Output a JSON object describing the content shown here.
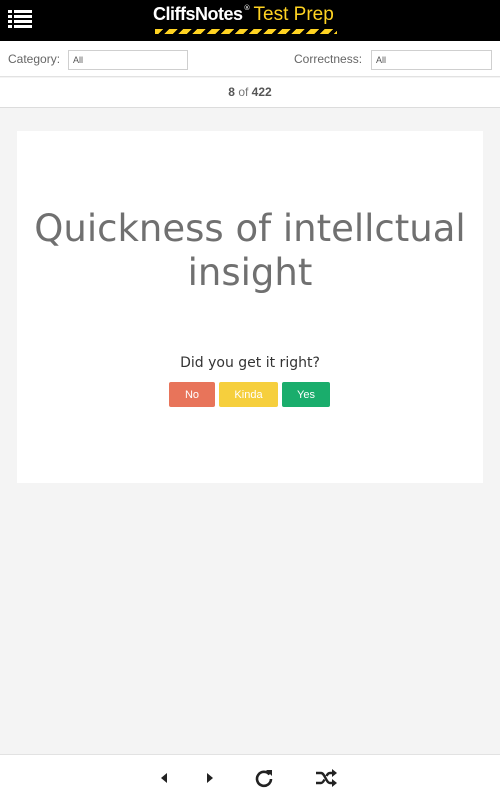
{
  "header": {
    "logo_main": "CliffsNotes",
    "logo_reg": "®",
    "logo_sub": "Test Prep",
    "menu_icon": "hamburger-list-icon"
  },
  "filters": {
    "category_label": "Category:",
    "category_value": "All",
    "correctness_label": "Correctness:",
    "correctness_value": "All"
  },
  "counter": {
    "current": "8",
    "of_text": "of",
    "total": "422"
  },
  "card": {
    "term": "Quickness of intellctual insight",
    "question": "Did you get it right?",
    "buttons": {
      "no": "No",
      "kinda": "Kinda",
      "yes": "Yes"
    }
  },
  "footer": {
    "icons": [
      "prev-arrow-icon",
      "next-arrow-icon",
      "refresh-icon",
      "shuffle-icon"
    ]
  },
  "colors": {
    "header_bg": "#000000",
    "accent_yellow": "#ffd322",
    "no_button": "#e8745a",
    "kinda_button": "#f6cf3d",
    "yes_button": "#1aad6c"
  }
}
